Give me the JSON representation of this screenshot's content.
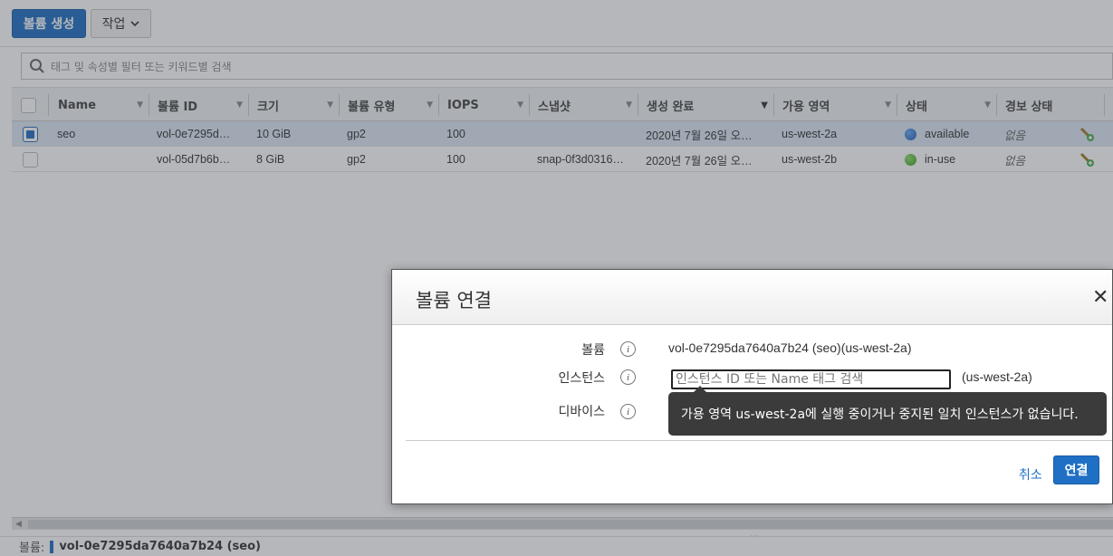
{
  "toolbar": {
    "create_volume_label": "볼륨 생성",
    "actions_label": "작업"
  },
  "search": {
    "placeholder": "태그 및 속성별 필터 또는 키워드별 검색"
  },
  "table": {
    "columns": [
      "Name",
      "볼륨 ID",
      "크기",
      "볼륨 유형",
      "IOPS",
      "스냅샷",
      "생성 완료",
      "가용 영역",
      "상태",
      "경보 상태"
    ],
    "rows": [
      {
        "selected": true,
        "name": "seo",
        "volume_id": "vol-0e7295d…",
        "size": "10 GiB",
        "type": "gp2",
        "iops": "100",
        "snapshot": "",
        "created": "2020년 7월 26일 오…",
        "az": "us-west-2a",
        "state": "available",
        "state_color": "#1c5fba",
        "alarm": "없음"
      },
      {
        "selected": false,
        "name": "",
        "volume_id": "vol-05d7b6b…",
        "size": "8 GiB",
        "type": "gp2",
        "iops": "100",
        "snapshot": "snap-0f3d0316…",
        "created": "2020년 7월 26일 오…",
        "az": "us-west-2b",
        "state": "in-use",
        "state_color": "#3a9d22",
        "alarm": "없음"
      }
    ]
  },
  "bottom_bar": {
    "label": "볼륨:",
    "value": "vol-0e7295da7640a7b24 (seo)"
  },
  "modal": {
    "title": "볼륨 연결",
    "volume_label": "볼륨",
    "volume_value": "vol-0e7295da7640a7b24 (seo)(us-west-2a)",
    "instance_label": "인스턴스",
    "instance_placeholder": "인스턴스 ID 또는 Name 태그 검색",
    "instance_az": "(us-west-2a)",
    "device_label": "디바이스",
    "tooltip": "가용 영역 us-west-2a에 실행 중이거나 중지된 일치 인스턴스가 없습니다.",
    "cancel_label": "취소",
    "connect_label": "연결"
  },
  "colors": {
    "accent": "#1f6fc5",
    "available": "#1c5fba",
    "in_use": "#3a9d22"
  }
}
